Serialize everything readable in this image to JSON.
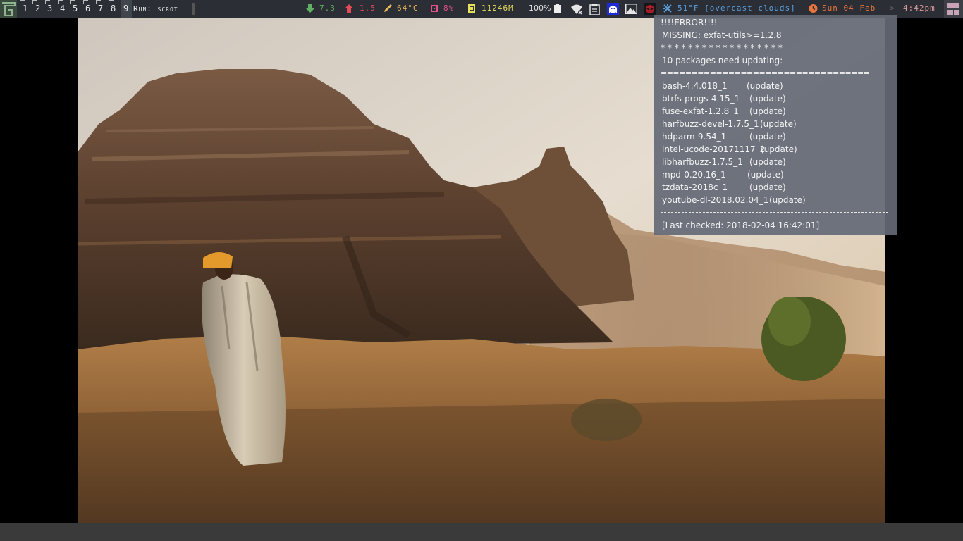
{
  "taskbar": {
    "workspaces": [
      "1",
      "2",
      "3",
      "4",
      "5",
      "6",
      "7",
      "8",
      "9"
    ],
    "run_label": "Run: scrot",
    "download": "7.3",
    "upload": "1.5",
    "temperature": "64°C",
    "cpu": "8%",
    "memory": "11246M",
    "battery": "100%",
    "weather": "51°F [overcast clouds]",
    "date": "Sun 04 Feb",
    "separator": ">",
    "time": "4:42pm",
    "colors": {
      "download": "#5fb15f",
      "upload": "#e34a5a",
      "temperature": "#e9b95a",
      "cpu": "#e0528a",
      "memory": "#e9e05a",
      "weather": "#5aa0e0",
      "date": "#e8743f",
      "time": "#d89a9a"
    },
    "icons": [
      "arrow-down-icon",
      "arrow-up-icon",
      "thermometer-icon",
      "cpu-icon",
      "memory-icon",
      "battery-icon",
      "wifi-icon",
      "clipboard-icon",
      "ghost-icon",
      "image-icon",
      "avatar-icon",
      "weather-icon",
      "clock-icon"
    ]
  },
  "popup": {
    "error_title": "!!!!ERROR!!!!",
    "missing": "MISSING: exfat-utils>=1.2.8",
    "stars": "* * * * * * * * * * * * * * * * * *",
    "summary": "10 packages need updating:",
    "rule": "==================================",
    "packages": [
      {
        "name": "bash-4.4.018_1",
        "status": "(update)"
      },
      {
        "name": "btrfs-progs-4.15_1",
        "status": "(update)"
      },
      {
        "name": "fuse-exfat-1.2.8_1",
        "status": "(update)"
      },
      {
        "name": "harfbuzz-devel-1.7.5_1",
        "status": "(update)"
      },
      {
        "name": "hdparm-9.54_1",
        "status": "(update)"
      },
      {
        "name": "intel-ucode-20171117_2",
        "status": "(update)"
      },
      {
        "name": "libharfbuzz-1.7.5_1",
        "status": "(update)"
      },
      {
        "name": "mpd-0.20.16_1",
        "status": "(update)"
      },
      {
        "name": "tzdata-2018c_1",
        "status": "(update)"
      },
      {
        "name": "youtube-dl-2018.02.04_1",
        "status": "(update)"
      }
    ],
    "last_checked": "[Last checked: 2018-02-04 16:42:01]"
  }
}
